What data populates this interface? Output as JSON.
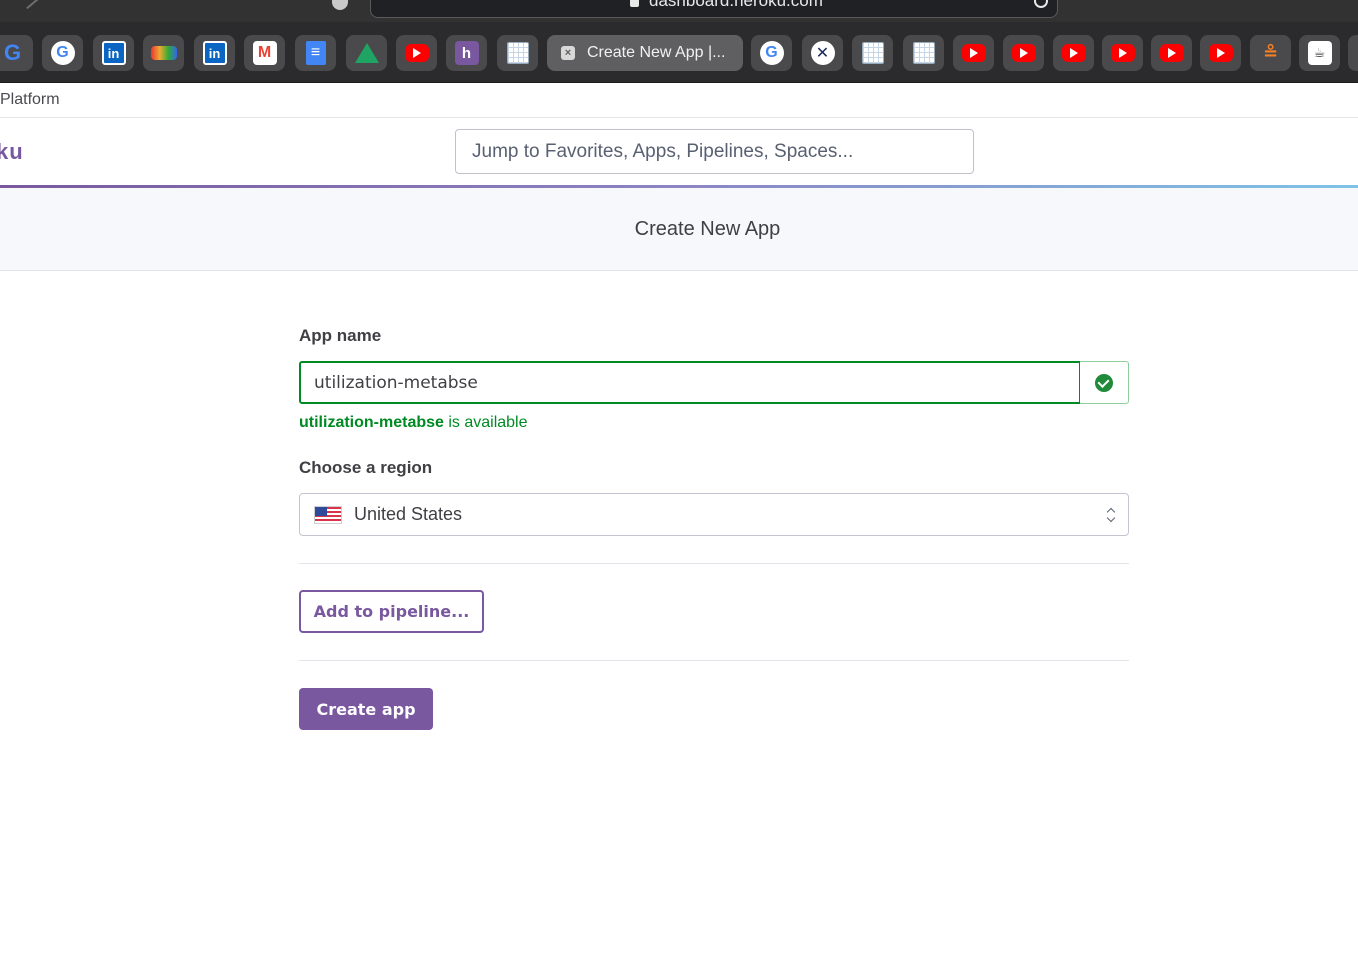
{
  "browser": {
    "url": "dashboard.heroku.com",
    "active_tab": {
      "title": "Create New App |..."
    },
    "pinned_tabs": [
      "google-g-icon",
      "google-icon",
      "linkedin-icon",
      "rawgraphs-icon",
      "linkedin-icon",
      "gmail-icon",
      "google-docs-icon",
      "google-drive-icon",
      "youtube-icon",
      "heroku-icon",
      "grid-icon",
      "google-icon",
      "atom-icon",
      "grid-icon",
      "grid-icon",
      "youtube-icon",
      "youtube-icon",
      "youtube-icon",
      "youtube-icon",
      "youtube-icon",
      "youtube-icon",
      "stackoverflow-icon",
      "coffee-icon"
    ]
  },
  "platform_bar": {
    "label": "Platform"
  },
  "header": {
    "logo_text": "ku",
    "search_placeholder": "Jump to Favorites, Apps, Pipelines, Spaces..."
  },
  "page": {
    "title": "Create New App"
  },
  "form": {
    "app_name_label": "App name",
    "app_name_value": "utilization-metabse",
    "availability_name": "utilization-metabse",
    "availability_suffix": " is available",
    "region_label": "Choose a region",
    "region_value": "United States",
    "pipeline_button": "Add to pipeline...",
    "create_button": "Create app"
  },
  "colors": {
    "brand_purple": "#79589f",
    "success_green": "#008a23",
    "chrome_dark": "#2b2b2d"
  }
}
